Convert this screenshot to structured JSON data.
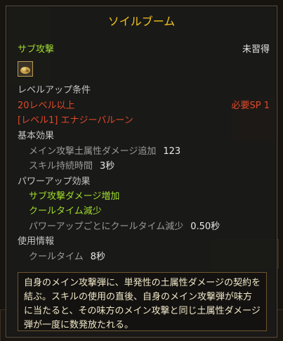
{
  "tooltip": {
    "title": "ソイルブーム",
    "skill_type": "サブ攻撃",
    "status": "未習得",
    "icon": "soil-skill-icon",
    "levelup": {
      "heading": "レベルアップ条件",
      "level_req": "20レベル以上",
      "sp_req": "必要SP 1",
      "prereq": "[レベル1] エナジーバルーン"
    },
    "basic": {
      "heading": "基本効果",
      "effects": [
        {
          "label": "メイン攻撃土属性ダメージ追加",
          "value": "123"
        },
        {
          "label": "スキル持続時間",
          "value": "3秒"
        }
      ]
    },
    "powerup": {
      "heading": "パワーアップ効果",
      "items": [
        "サブ攻撃ダメージ増加",
        "クールタイム減少"
      ],
      "detail_label": "パワーアップごとにクールタイム減少",
      "detail_value": "0.50秒"
    },
    "usage": {
      "heading": "使用情報",
      "cooldown_label": "クールタイム",
      "cooldown_value": "8秒"
    },
    "description": "自身のメイン攻撃弾に、単発性の土属性ダメージの契約を結ぶ。スキルの使用の直後、自身のメイン攻撃弾が味方に当たると、その味方のメイン攻撃と同じ土属性ダメージ弾が一度に数発放たれる。"
  },
  "colors": {
    "title": "#f0c21a",
    "green": "#9fdc2c",
    "red": "#e04a2a",
    "desc_border": "#6f5630"
  }
}
